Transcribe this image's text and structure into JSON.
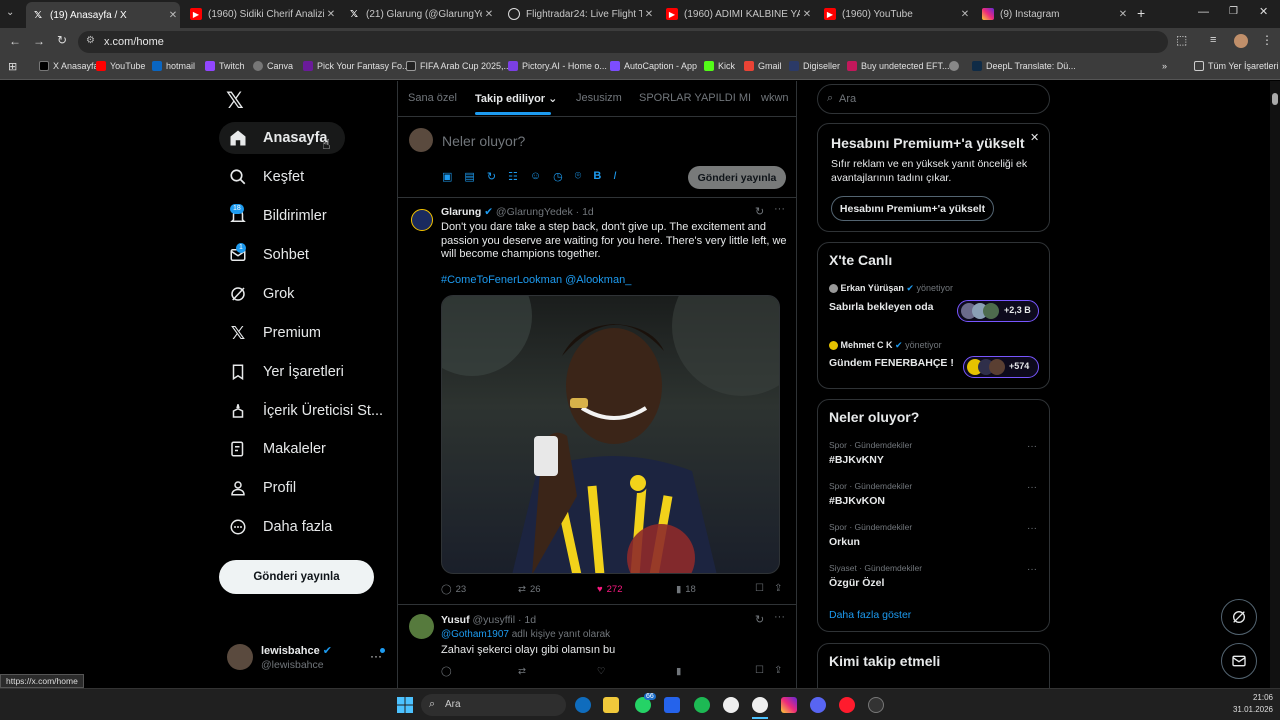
{
  "browser": {
    "tabs": [
      {
        "title": "(19) Anasayfa / X",
        "icon": "x-logo-icon"
      },
      {
        "title": "(1960) Sidiki Cherif Analizi: Fen",
        "icon": "youtube-icon"
      },
      {
        "title": "(21) Glarung (@GlarungYedek)",
        "icon": "x-logo-icon"
      },
      {
        "title": "Flightradar24: Live Flight Tracke",
        "icon": "flightradar-icon"
      },
      {
        "title": "(1960) ADIMI KALBİNE YAZ X B",
        "icon": "youtube-icon"
      },
      {
        "title": "(1960) YouTube",
        "icon": "youtube-icon"
      },
      {
        "title": "(9) Instagram",
        "icon": "instagram-icon"
      }
    ],
    "url": "x.com/home",
    "bookmarks": [
      "X Anasayfa",
      "YouTube",
      "hotmail",
      "Twitch",
      "Canva",
      "Pick Your Fantasy Fo...",
      "FIFA Arab Cup 2025,...",
      "Pictory.AI - Home o...",
      "AutoCaption - App",
      "Kick",
      "Gmail",
      "Digiseller",
      "Buy undetected EFT...",
      "",
      "DeepL Translate: Dü..."
    ],
    "all_bookmarks": "Tüm Yer İşaretleri",
    "status_url": "https://x.com/home"
  },
  "nav": {
    "items": [
      {
        "label": "Anasayfa",
        "icon": "home-icon"
      },
      {
        "label": "Keşfet",
        "icon": "search-icon"
      },
      {
        "label": "Bildirimler",
        "icon": "bell-icon",
        "badge": "18"
      },
      {
        "label": "Sohbet",
        "icon": "mail-icon",
        "badge": "1"
      },
      {
        "label": "Grok",
        "icon": "grok-icon"
      },
      {
        "label": "Premium",
        "icon": "x-logo-icon"
      },
      {
        "label": "Yer İşaretleri",
        "icon": "bookmark-icon"
      },
      {
        "label": "İçerik Üreticisi St...",
        "icon": "creator-studio-icon"
      },
      {
        "label": "Makaleler",
        "icon": "article-icon"
      },
      {
        "label": "Profil",
        "icon": "profile-icon"
      },
      {
        "label": "Daha fazla",
        "icon": "more-circle-icon"
      }
    ],
    "post_button": "Gönderi yayınla",
    "account": {
      "name": "lewisbahce",
      "handle": "@lewisbahce"
    }
  },
  "feed": {
    "tabs": [
      "Sana özel",
      "Takip ediliyor",
      "Jesusizm",
      "SPORLAR YAPILDI MI",
      "wkwn"
    ],
    "active_tab": 1,
    "composer_placeholder": "Neler oluyor?",
    "composer_button": "Gönderi yayınla",
    "posts": [
      {
        "name": "Glarung",
        "handle": "@GlarungYedek",
        "time": "1d",
        "text": "Don't you dare take a step back, don't give up. The excitement and passion you deserve are waiting for you here. There's very little left, we will become champions together.",
        "hashtag_line": "#ComeToFenerLookman @Alookman_",
        "stats": {
          "replies": "23",
          "reposts": "26",
          "likes": "272",
          "views": "18"
        }
      },
      {
        "name": "Yusuf",
        "handle": "@yusyffil",
        "time": "1d",
        "reply_to_handle": "@Gotham1907",
        "reply_to_suffix": "adlı kişiye yanıt olarak",
        "text": "Zahavi şekerci olayı gibi olamsın bu"
      }
    ]
  },
  "sidebar": {
    "search_placeholder": "Ara",
    "premium": {
      "title": "Hesabını Premium+'a yükselt",
      "body": "Sıfır reklam ve en yüksek yanıt önceliği ek avantajlarının tadını çıkar.",
      "button": "Hesabını Premium+'a yükselt"
    },
    "live": {
      "title": "X'te Canlı",
      "items": [
        {
          "host": "Erkan Yürüşan",
          "role": "yönetiyor",
          "title": "Sabırla bekleyen oda",
          "count": "+2,3 B"
        },
        {
          "host": "Mehmet C K",
          "role": "yönetiyor",
          "title": "Gündem FENERBAHÇE !",
          "count": "+574"
        }
      ]
    },
    "trends": {
      "title": "Neler oluyor?",
      "items": [
        {
          "meta": "Spor · Gündemdekiler",
          "name": "#BJKvKNY"
        },
        {
          "meta": "Spor · Gündemdekiler",
          "name": "#BJKvKON"
        },
        {
          "meta": "Spor · Gündemdekiler",
          "name": "Orkun"
        },
        {
          "meta": "Siyaset · Gündemdekiler",
          "name": "Özgür Özel"
        }
      ],
      "show_more": "Daha fazla göster"
    },
    "who_to_follow": "Kimi takip etmeli"
  },
  "taskbar": {
    "search": "Ara",
    "time": "21:06",
    "date": "31.01.2026",
    "whatsapp_badge": "66"
  },
  "colors": {
    "accent": "#1d9bf0",
    "like": "#f91880",
    "bg": "#000000"
  }
}
